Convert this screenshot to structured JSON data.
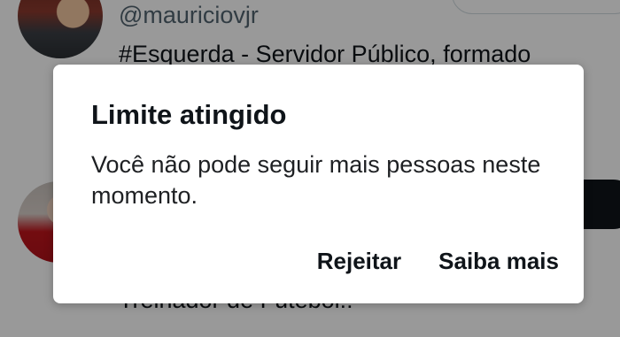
{
  "feed": {
    "user1": {
      "handle": "@mauriciovjr",
      "bio_line1": "#Esquerda - Servidor Público, formado"
    },
    "user2": {
      "bio_line": "Treinador de Futebol!!"
    }
  },
  "dialog": {
    "title": "Limite atingido",
    "message": "Você não pode seguir mais pessoas neste momento.",
    "reject_label": "Rejeitar",
    "learn_more_label": "Saiba mais"
  },
  "colors": {
    "overlay": "#00000066",
    "dialog_bg": "#ffffff",
    "text_primary": "#0f1419",
    "text_secondary": "#536471"
  }
}
